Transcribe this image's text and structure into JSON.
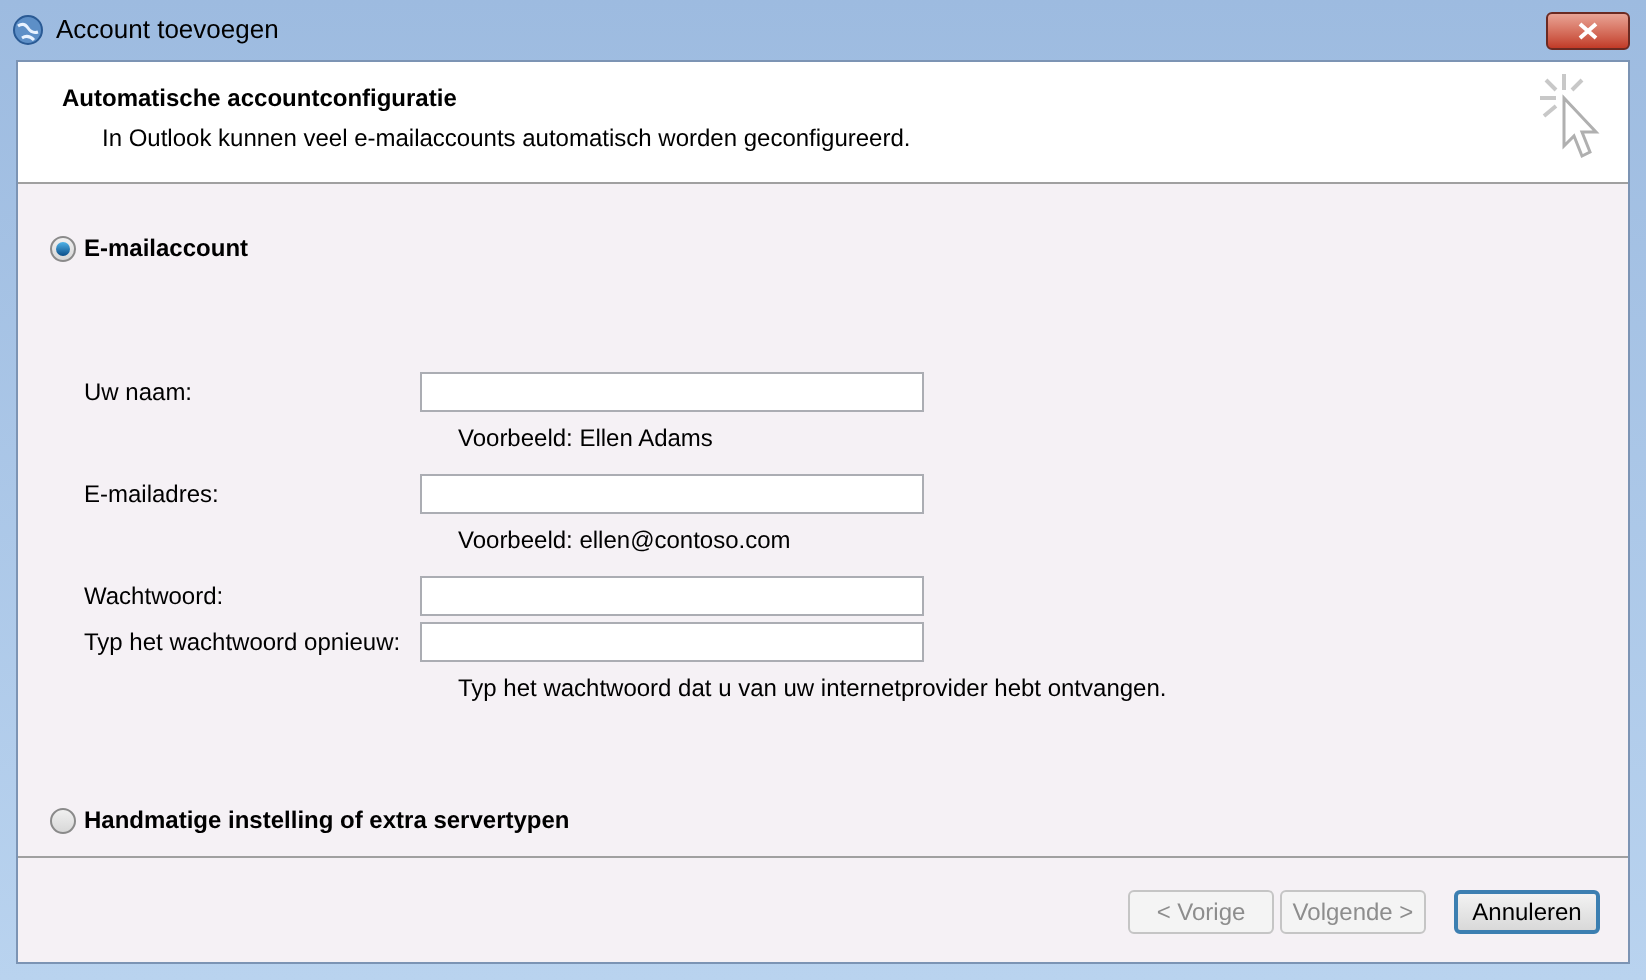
{
  "window": {
    "title": "Account toevoegen"
  },
  "header": {
    "title": "Automatische accountconfiguratie",
    "subtitle": "In Outlook kunnen veel e-mailaccounts automatisch worden geconfigureerd."
  },
  "options": [
    {
      "label": "E-mailaccount",
      "selected": true
    },
    {
      "label": "Handmatige instelling of extra servertypen",
      "selected": false
    }
  ],
  "fields": [
    {
      "label": "Uw naam:",
      "hint": "Voorbeeld: Ellen Adams"
    },
    {
      "label": "E-mailadres:",
      "hint": "Voorbeeld: ellen@contoso.com"
    },
    {
      "label": "Wachtwoord:"
    },
    {
      "label": "Typ het wachtwoord opnieuw:",
      "hint": "Typ het wachtwoord dat u van uw internetprovider hebt ontvangen."
    }
  ],
  "buttons": [
    {
      "label": "< Vorige",
      "disabled": true,
      "default": false
    },
    {
      "label": "Volgende >",
      "disabled": true,
      "default": false
    },
    {
      "label": "Annuleren",
      "disabled": false,
      "default": true
    }
  ]
}
